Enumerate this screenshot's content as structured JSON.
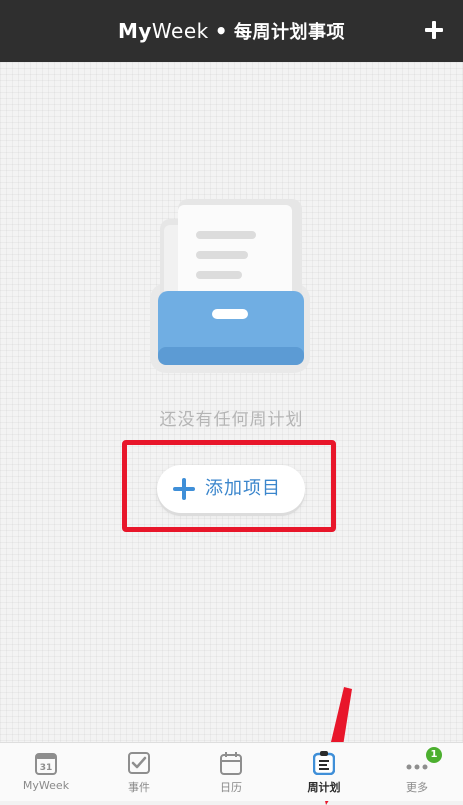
{
  "header": {
    "title_bold": "My",
    "title_light": "Week",
    "separator": "•",
    "title_cn": "每周计划事项",
    "add_icon": "plus-icon"
  },
  "main": {
    "empty_text": "还没有任何周计划",
    "add_button_label": "添加项目",
    "illustration": "empty-drawer-illustration"
  },
  "tabs": [
    {
      "label": "MyWeek",
      "icon": "calendar-31-icon",
      "icon_text": "31",
      "active": false
    },
    {
      "label": "事件",
      "icon": "checkbox-icon",
      "active": false
    },
    {
      "label": "日历",
      "icon": "calendar-icon",
      "active": false
    },
    {
      "label": "周计划",
      "icon": "clipboard-icon",
      "active": true
    },
    {
      "label": "更多",
      "icon": "more-dots-icon",
      "badge": "1",
      "active": false
    }
  ],
  "colors": {
    "header_bg": "#2f2f2f",
    "accent_blue": "#3f8fd8",
    "highlight_red": "#e8162a",
    "badge_green": "#4caf2f"
  }
}
